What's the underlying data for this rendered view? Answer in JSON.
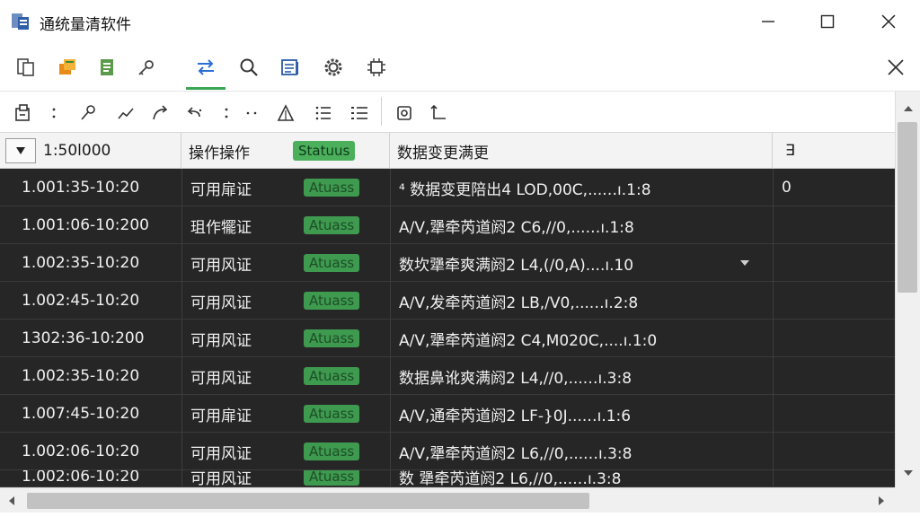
{
  "window": {
    "title": "通统量清软件",
    "controls": [
      "minimize-icon",
      "maximize-icon",
      "close-icon"
    ]
  },
  "toolbar_main": {
    "buttons": [
      "copy-icon",
      "folders-icon",
      "document-icon",
      "key-gear-icon",
      "transfer-icon",
      "search-icon",
      "report-icon",
      "settings-gear-icon",
      "chip-icon"
    ],
    "active_index": 4,
    "close_icon": "close-icon"
  },
  "toolbar_secondary": {
    "buttons": [
      "import-icon",
      "more-vertical-icon",
      "key-icon",
      "curve-icon",
      "redo-icon",
      "undo-icon",
      "more-vertical-icon",
      "more-horizontal-icon",
      "triangle-icon",
      "list-icon",
      "bullet-list-icon",
      "gear-cycle-icon",
      "corner-arrow-icon"
    ]
  },
  "table": {
    "headers": {
      "col1": "1:50l000",
      "col2": "操作操作",
      "col2_badge": "Statuus",
      "col3": "数据变更满更",
      "col4": "∃"
    },
    "rows": [
      {
        "time": "1.001:35-10:20",
        "op": "可用扉证",
        "status": "Atuass",
        "desc": "⁴ 数据变更陪出4 LOD,00C,....‥ı.1:8",
        "extra": "0"
      },
      {
        "time": "1.001:06-10:200",
        "op": "珇作犤证",
        "status": "Atuass",
        "desc": "A/V,犟牵芮道阏2 C6,//0,....‥ı.1:8",
        "extra": ""
      },
      {
        "time": "1.002:35-10:20",
        "op": "可用风证",
        "status": "Atuass",
        "desc": "数坎犟牵爽满阏2 L4,(/0,A)....ı.10",
        "extra": ""
      },
      {
        "time": "1.002:45-10:20",
        "op": "可用风证",
        "status": "Atuass",
        "desc": "A/V,发牵芮道阏2 LB,/V0,....‥ı.2:8",
        "extra": ""
      },
      {
        "time": "1302:36-10:200",
        "op": "可用风证",
        "status": "Atuass",
        "desc": "A/V,犟牵芮道阏2 C4,M020C,....ı.1:0",
        "extra": ""
      },
      {
        "time": "1.002:35-10:20",
        "op": "可用风证",
        "status": "Atuass",
        "desc": "数据鼻讹爽满阏2 L4,//0,....‥ı.3:8",
        "extra": ""
      },
      {
        "time": "1.007:45-10:20",
        "op": "可用扉证",
        "status": "Atuass",
        "desc": "A/V,通牵芮道阏2 LF-}0J....‥ı.1:6",
        "extra": ""
      },
      {
        "time": "1.002:06-10:20",
        "op": "可用风证",
        "status": "Atuass",
        "desc": "A/V,犟牵芮道阏2 L6,//0,....‥ı.3:8",
        "extra": ""
      },
      {
        "time": "1.002:06-10:20",
        "op": "可用风证",
        "status": "Atuass",
        "desc": "数 犟牵芮道阏2 L6,//0,....‥ı.3:8",
        "extra": ""
      }
    ]
  },
  "colors": {
    "accent": "#3aa655",
    "badge": "#4caf5c",
    "grid_bg": "#262626"
  }
}
